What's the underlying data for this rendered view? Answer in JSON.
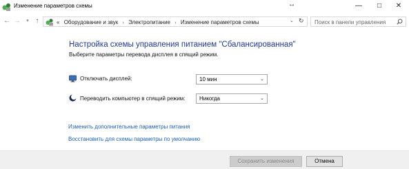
{
  "window": {
    "title": "Изменение параметров схемы",
    "app_icon": "power-options-icon",
    "resize_glyph": "↔",
    "minimize_glyph": "—",
    "maximize_glyph": "□",
    "close_glyph": "✕"
  },
  "navigation": {
    "back_glyph": "←",
    "forward_glyph": "→",
    "recent_glyph": "▾",
    "up_glyph": "↑",
    "prefix": "«",
    "breadcrumbs": [
      "Оборудование и звук",
      "Электропитание",
      "Изменение параметров схемы"
    ],
    "separator": "›",
    "dropdown_glyph": "⌄",
    "refresh_glyph": "↻"
  },
  "search": {
    "placeholder": "Поиск в панели управления"
  },
  "content": {
    "title": "Настройка схемы управления питанием \"Сбалансированная\"",
    "subtitle": "Выберите параметры перевода дисплея в спящий режим.",
    "display_off": {
      "label": "Отключать дисплей:",
      "value": "10 мин",
      "icon": "monitor-icon"
    },
    "sleep": {
      "label": "Переводить компьютер в спящий режим:",
      "value": "Никогда",
      "icon": "moon-icon"
    },
    "links": {
      "advanced": "Изменить дополнительные параметры питания",
      "restore": "Восстановить для схемы параметры по умолчанию"
    }
  },
  "footer": {
    "save_label": "Сохранить изменения",
    "save_enabled": false,
    "cancel_label": "Отмена"
  },
  "colors": {
    "title_blue": "#1e3b8a",
    "link_blue": "#1a5fb4",
    "footer_bg": "#f0f0f0"
  }
}
